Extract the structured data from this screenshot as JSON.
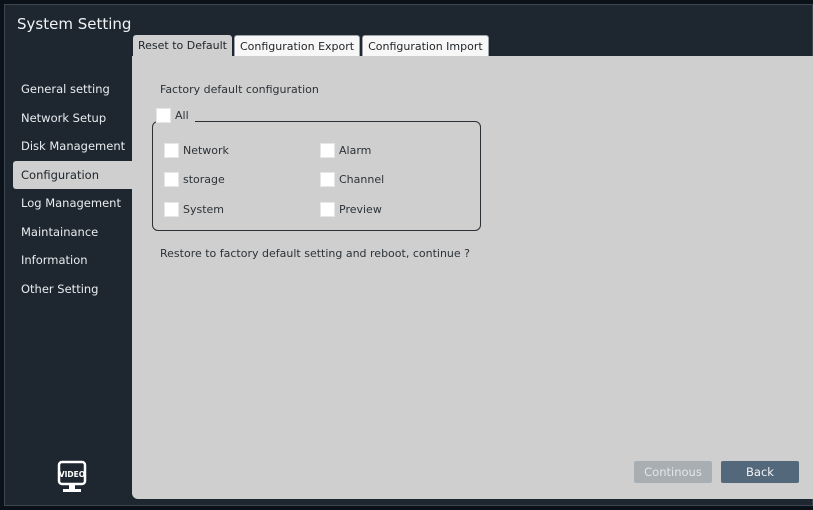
{
  "window": {
    "title": "System Setting"
  },
  "tabs": [
    {
      "label": "Reset to Default",
      "active": true
    },
    {
      "label": "Configuration Export",
      "active": false
    },
    {
      "label": "Configuration Import",
      "active": false
    }
  ],
  "sidebar": {
    "items": [
      {
        "label": "General setting"
      },
      {
        "label": "Network Setup"
      },
      {
        "label": "Disk Management"
      },
      {
        "label": "Configuration",
        "active": true
      },
      {
        "label": "Log Management"
      },
      {
        "label": "Maintainance"
      },
      {
        "label": "Information"
      },
      {
        "label": "Other Setting"
      }
    ],
    "logo_text": "VIDEO"
  },
  "panel": {
    "heading": "Factory default configuration",
    "all_label": "All",
    "options": [
      {
        "label": "Network",
        "checked": false
      },
      {
        "label": "Alarm",
        "checked": false
      },
      {
        "label": "storage",
        "checked": false
      },
      {
        "label": "Channel",
        "checked": false
      },
      {
        "label": "System",
        "checked": false
      },
      {
        "label": "Preview",
        "checked": false
      }
    ],
    "message": "Restore to factory default setting and reboot, continue ?",
    "buttons": {
      "continue": "Continous",
      "back": "Back"
    }
  },
  "colors": {
    "window_bg": "#1e262f",
    "panel_bg": "#cfcfcf",
    "back_button": "#53687b",
    "continue_button_disabled": "#a8aeb2"
  }
}
